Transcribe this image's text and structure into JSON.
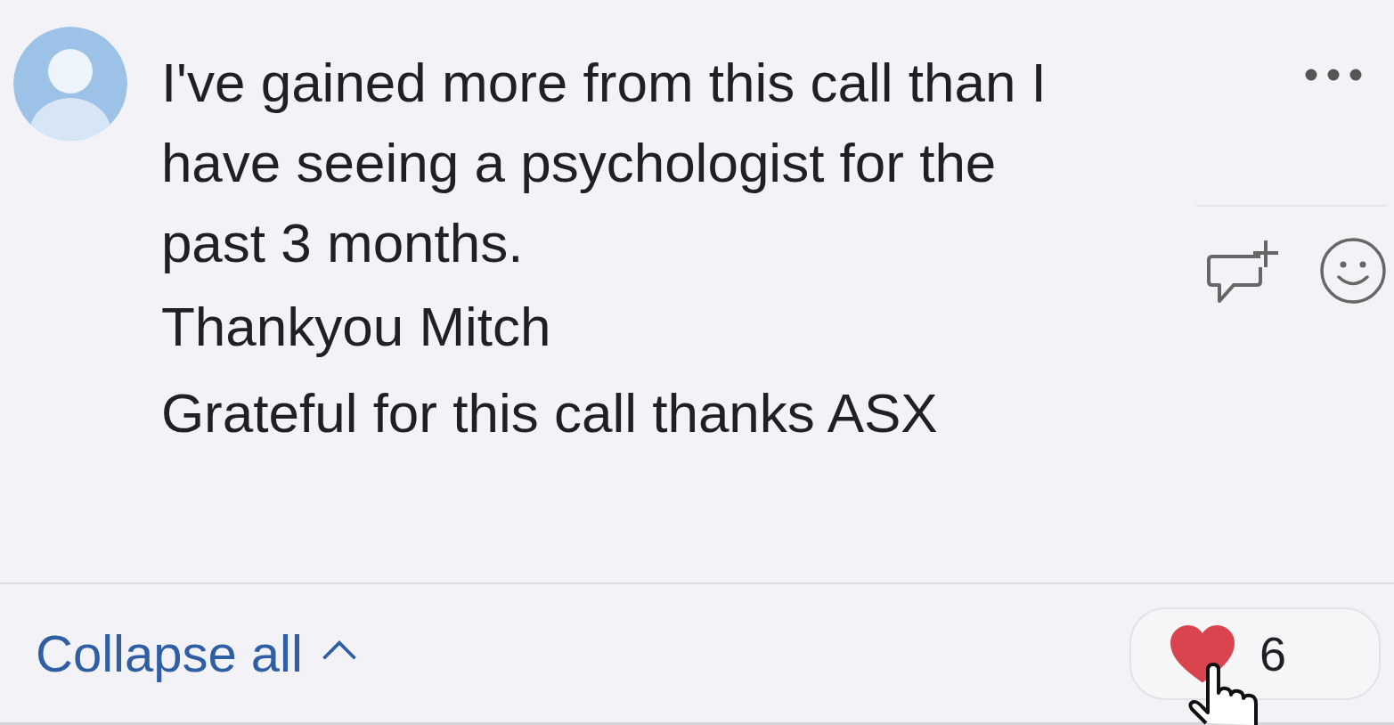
{
  "comment": {
    "text": "I've gained more from this call than I have seeing a psychologist for the past 3 months."
  },
  "replies": [
    {
      "text": "Thankyou Mitch"
    },
    {
      "text": "Grateful for this call thanks ASX"
    }
  ],
  "footer": {
    "collapse_label": "Collapse all",
    "like": {
      "count": "6",
      "selected": true
    }
  }
}
